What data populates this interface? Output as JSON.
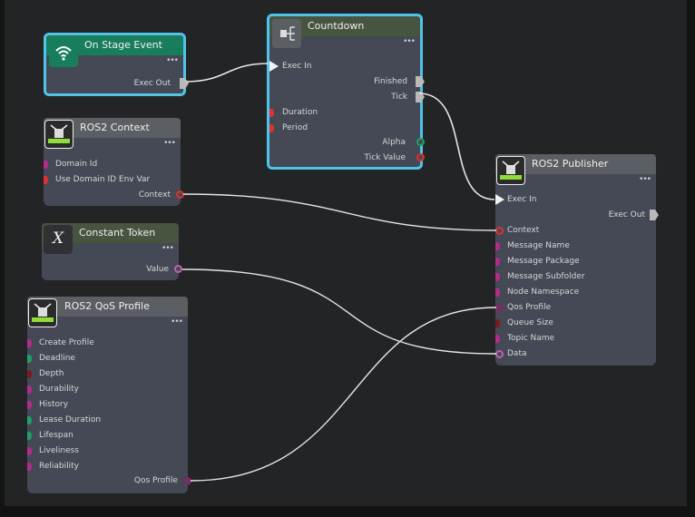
{
  "nodes": {
    "on_stage_event": {
      "title": "On Stage Event",
      "icon": "wifi-icon",
      "outputs": [
        "Exec Out"
      ]
    },
    "countdown": {
      "title": "Countdown",
      "icon": "flow-icon",
      "inputs": [
        "Exec In",
        "Duration",
        "Period"
      ],
      "outputs": [
        "Finished",
        "Tick",
        "Alpha",
        "Tick Value"
      ]
    },
    "ros2_context": {
      "title": "ROS2 Context",
      "icon": "ros-icon",
      "inputs": [
        "Domain Id",
        "Use Domain ID Env Var"
      ],
      "outputs": [
        "Context"
      ]
    },
    "constant_token": {
      "title": "Constant Token",
      "icon": "variable-x-icon",
      "icon_glyph": "X",
      "outputs": [
        "Value"
      ]
    },
    "qos_profile": {
      "title": "ROS2 QoS Profile",
      "icon": "ros-icon",
      "inputs": [
        "Create Profile",
        "Deadline",
        "Depth",
        "Durability",
        "History",
        "Lease Duration",
        "Lifespan",
        "Liveliness",
        "Reliability"
      ],
      "outputs": [
        "Qos Profile"
      ]
    },
    "ros2_publisher": {
      "title": "ROS2 Publisher",
      "icon": "ros-icon",
      "inputs": [
        "Exec In",
        "Context",
        "Message Name",
        "Message Package",
        "Message Subfolder",
        "Node Namespace",
        "Qos Profile",
        "Queue Size",
        "Topic Name",
        "Data"
      ],
      "outputs": [
        "Exec Out"
      ]
    }
  },
  "more_glyph": "•••",
  "colors": {
    "canvas": "#232425",
    "node_body": "#444955",
    "selected_border": "#4fc3ea",
    "pin_magenta": "#b42a8c",
    "pin_red": "#e03030",
    "pin_dark_red": "#7a1c1c",
    "pin_green": "#1fa067",
    "pin_token": "#c060b0",
    "exec": "#f2f2f2",
    "wire": "#e6e6e6"
  }
}
